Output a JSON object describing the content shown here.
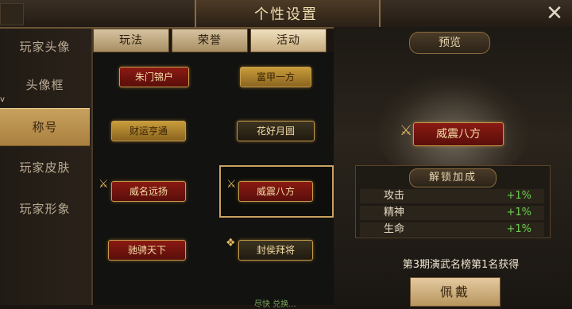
{
  "header": {
    "title": "个性设置",
    "close_icon": "close-icon"
  },
  "sidebar": {
    "items": [
      {
        "label": "玩家头像"
      },
      {
        "label": "头像框"
      },
      {
        "label": "称号",
        "selected": true
      },
      {
        "label": "玩家皮肤"
      },
      {
        "label": "玩家形象"
      }
    ]
  },
  "tabs": [
    {
      "label": "玩法"
    },
    {
      "label": "荣誉"
    },
    {
      "label": "活动",
      "selected": true
    }
  ],
  "titles_grid": [
    {
      "text": "朱门锦户"
    },
    {
      "text": "富甲一方"
    },
    {
      "text": "财运亨通"
    },
    {
      "text": "花好月圆"
    },
    {
      "text": "威名远扬"
    },
    {
      "text": "威震八方",
      "selected": true
    },
    {
      "text": "驰骋天下"
    },
    {
      "text": "封侯拜将"
    }
  ],
  "grid_footer_hint": "尽快 兑换...",
  "preview": {
    "label": "预览",
    "title": "威震八方",
    "bonus": {
      "title": "解锁加成",
      "rows": [
        {
          "name": "攻击",
          "value": "+1%"
        },
        {
          "name": "精神",
          "value": "+1%"
        },
        {
          "name": "生命",
          "value": "+1%"
        }
      ]
    },
    "unlock_text": "第3期演武名榜第1名获得",
    "wear_button": "佩戴"
  },
  "colors": {
    "accent": "#c9a15e",
    "bonus_value": "#6bd04f",
    "title_red": "#8a1a12"
  }
}
